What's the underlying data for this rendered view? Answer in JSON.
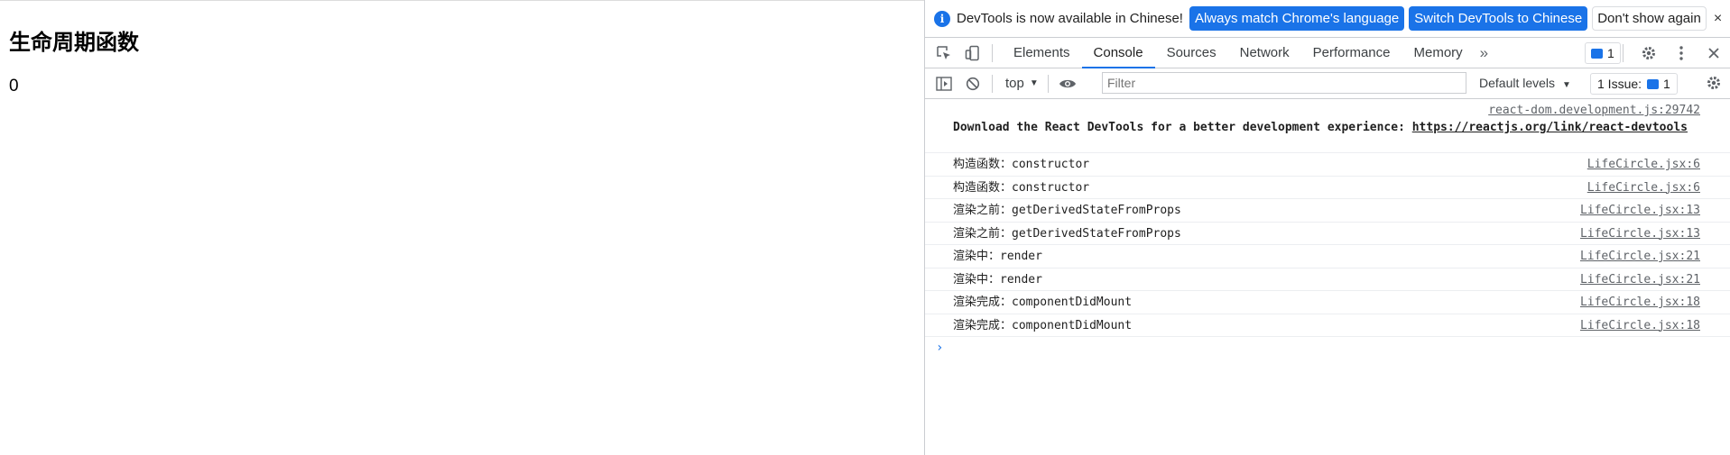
{
  "page": {
    "heading": "生命周期函数",
    "count": "0"
  },
  "devtools": {
    "infobar": {
      "text": "DevTools is now available in Chinese!",
      "match_button": "Always match Chrome's language",
      "switch_button": "Switch DevTools to Chinese",
      "dismiss_button": "Don't show again",
      "close": "×"
    },
    "tabs": [
      "Elements",
      "Console",
      "Sources",
      "Network",
      "Performance",
      "Memory"
    ],
    "active_tab": "Console",
    "more_tabs": "»",
    "issues_count": "1",
    "toolbar": {
      "context": "top",
      "filter_placeholder": "Filter",
      "levels": "Default levels",
      "issues_label": "1 Issue:",
      "issues_count": "1"
    },
    "console": {
      "first": {
        "source": "react-dom.development.js:29742",
        "text": "Download the React DevTools for a better development experience: ",
        "link": "https://reactjs.org/link/react-devtools"
      },
      "logs": [
        {
          "message": "构造函数：constructor",
          "source": "LifeCircle.jsx:6"
        },
        {
          "message": "构造函数：constructor",
          "source": "LifeCircle.jsx:6"
        },
        {
          "message": "渲染之前：getDerivedStateFromProps",
          "source": "LifeCircle.jsx:13"
        },
        {
          "message": "渲染之前：getDerivedStateFromProps",
          "source": "LifeCircle.jsx:13"
        },
        {
          "message": "渲染中：render",
          "source": "LifeCircle.jsx:21"
        },
        {
          "message": "渲染中：render",
          "source": "LifeCircle.jsx:21"
        },
        {
          "message": "渲染完成：componentDidMount",
          "source": "LifeCircle.jsx:18"
        },
        {
          "message": "渲染完成：componentDidMount",
          "source": "LifeCircle.jsx:18"
        }
      ],
      "prompt": "›"
    },
    "colors": {
      "accent": "#1a73e8",
      "border": "#cbcdd1"
    }
  }
}
